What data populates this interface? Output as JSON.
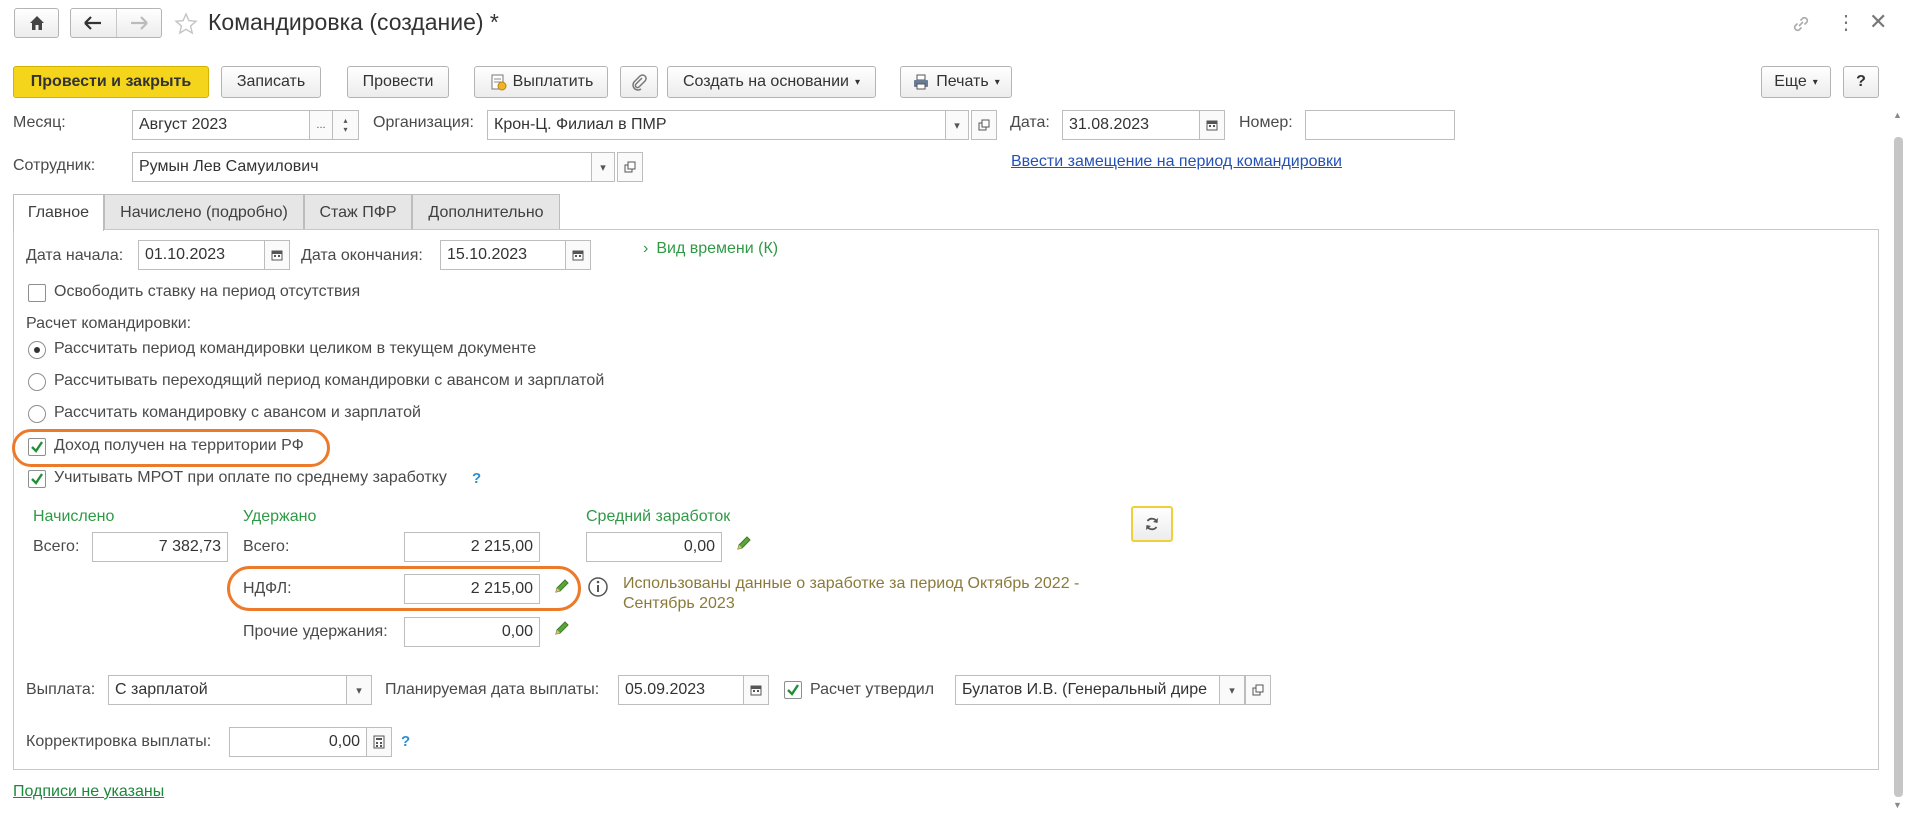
{
  "window": {
    "title": "Командировка (создание) *"
  },
  "toolbar": {
    "post_close": "Провести и закрыть",
    "save": "Записать",
    "post": "Провести",
    "pay": "Выплатить",
    "create_based": "Создать на основании",
    "print": "Печать",
    "more": "Еще",
    "help": "?"
  },
  "header": {
    "month_label": "Месяц:",
    "month_value": "Август 2023",
    "org_label": "Организация:",
    "org_value": "Крон-Ц. Филиал в ПМР",
    "date_label": "Дата:",
    "date_value": "31.08.2023",
    "number_label": "Номер:",
    "number_value": "",
    "employee_label": "Сотрудник:",
    "employee_value": "Румын Лев Самуилович",
    "substitute_link": "Ввести замещение на период командировки"
  },
  "tabs": [
    {
      "label": "Главное"
    },
    {
      "label": "Начислено (подробно)"
    },
    {
      "label": "Стаж ПФР"
    },
    {
      "label": "Дополнительно"
    }
  ],
  "main": {
    "start_label": "Дата начала:",
    "start_value": "01.10.2023",
    "end_label": "Дата окончания:",
    "end_value": "15.10.2023",
    "time_kind": "Вид времени (К)",
    "free_rate": "Освободить ставку на период отсутствия",
    "calc_label": "Расчет командировки:",
    "radios": [
      "Рассчитать период командировки целиком в текущем документе",
      "Рассчитывать переходящий период командировки с авансом и зарплатой",
      "Рассчитать командировку с авансом и зарплатой"
    ],
    "income_rf": "Доход получен на территории РФ",
    "mrot": "Учитывать МРОТ при оплате по среднему заработку",
    "mrot_help": "?",
    "accrued_title": "Начислено",
    "accrued_total_label": "Всего:",
    "accrued_total": "7 382,73",
    "withheld_title": "Удержано",
    "withheld_total_label": "Всего:",
    "withheld_total": "2 215,00",
    "ndfl_label": "НДФЛ:",
    "ndfl_value": "2 215,00",
    "other_label": "Прочие удержания:",
    "other_value": "0,00",
    "avg_title": "Средний заработок",
    "avg_value": "0,00",
    "info_text_1": "Использованы данные о заработке за период Октябрь 2022 -",
    "info_text_2": "Сентябрь 2023",
    "payout_label": "Выплата:",
    "payout_value": "С зарплатой",
    "planned_label": "Планируемая дата выплаты:",
    "planned_value": "05.09.2023",
    "approved_label": "Расчет утвердил",
    "approved_value": "Булатов И.В. (Генеральный дире",
    "correction_label": "Корректировка выплаты:",
    "correction_value": "0,00",
    "correction_help": "?"
  },
  "footer": {
    "signatures_link": "Подписи не указаны"
  },
  "colors": {
    "accent_yellow": "#f4d51c",
    "highlight_orange": "#ec7a2b",
    "label_green": "#2f9a46",
    "link_blue": "#2551b5"
  }
}
